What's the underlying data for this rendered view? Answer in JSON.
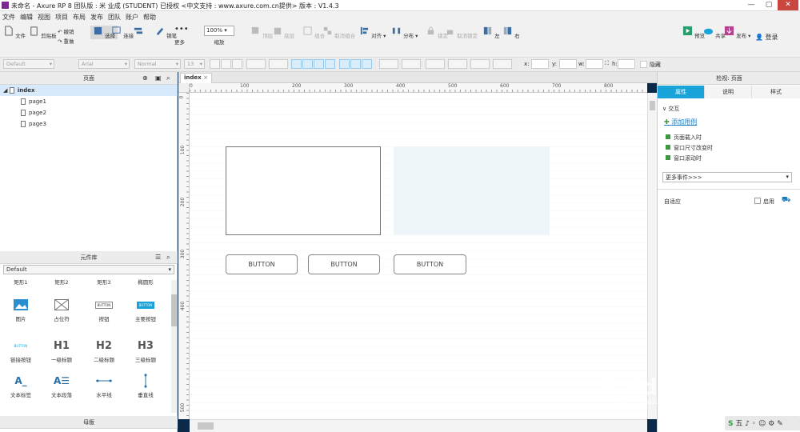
{
  "titlebar": {
    "title": "未命名 - Axure RP 8 团队版 : 米 业成 (STUDENT) 已授权 <中文支持 : www.axure.com.cn提供> 版本 : V1.4.3"
  },
  "menu": [
    "文件",
    "编辑",
    "视图",
    "项目",
    "布局",
    "发布",
    "团队",
    "账户",
    "帮助"
  ],
  "toolbar": {
    "file": "文件",
    "clipboard": "剪贴板",
    "undo": "撤销",
    "redo": "重做",
    "select": "选择",
    "connect": "连接",
    "pen": "钢笔",
    "more": "更多",
    "zoom_value": "100%",
    "zoom_label": "缩放",
    "top": "顶层",
    "bottom": "底层",
    "group": "组合",
    "ungroup": "取消组合",
    "align": "对齐",
    "distribute": "分布",
    "lock": "锁定",
    "unlock": "取消锁定",
    "left": "左",
    "right": "右",
    "preview": "预览",
    "share": "共享",
    "publish": "发布",
    "login": "登录"
  },
  "format": {
    "style": "Default",
    "font": "Arial",
    "weight": "Normal",
    "size": "13",
    "x": "x:",
    "y": "y:",
    "w": "w:",
    "h": "h:",
    "hidden": "隐藏"
  },
  "pages_panel": {
    "title": "页面",
    "root": "index",
    "pages": [
      "page1",
      "page2",
      "page3"
    ]
  },
  "library_panel": {
    "title": "元件库",
    "selected": "Default",
    "row0": [
      "矩形1",
      "矩形2",
      "矩形3",
      "椭圆形"
    ],
    "row1": [
      "图片",
      "占位符",
      "按钮",
      "主要按钮"
    ],
    "row2": [
      "链接按钮",
      "一级标题",
      "二级标题",
      "三级标题"
    ],
    "row3": [
      "文本标签",
      "文本段落",
      "水平线",
      "垂直线"
    ],
    "icon_button": "BUTTON",
    "icon_h1": "H1",
    "icon_h2": "H2",
    "icon_h3": "H3"
  },
  "masters_panel": {
    "title": "母版"
  },
  "tab": {
    "label": "index",
    "close": "×"
  },
  "ruler_h": [
    "0",
    "100",
    "200",
    "300",
    "400",
    "500",
    "600",
    "700",
    "800"
  ],
  "ruler_v": [
    "0",
    "100",
    "200",
    "300",
    "400",
    "500"
  ],
  "canvas": {
    "buttons": [
      "BUTTON",
      "BUTTON",
      "BUTTON"
    ]
  },
  "inspector": {
    "title": "检视: 页面",
    "tabs": [
      "属性",
      "说明",
      "样式"
    ],
    "section": "交互",
    "add_case": "添加用例",
    "events": [
      "页面载入时",
      "窗口尺寸改变时",
      "窗口滚动时"
    ],
    "more_events": "更多事件>>>",
    "adaptive": "自适应",
    "enable": "启用"
  },
  "watermark": {
    "text": "Baidu经验",
    "url": "jingyan.baidu.com"
  }
}
